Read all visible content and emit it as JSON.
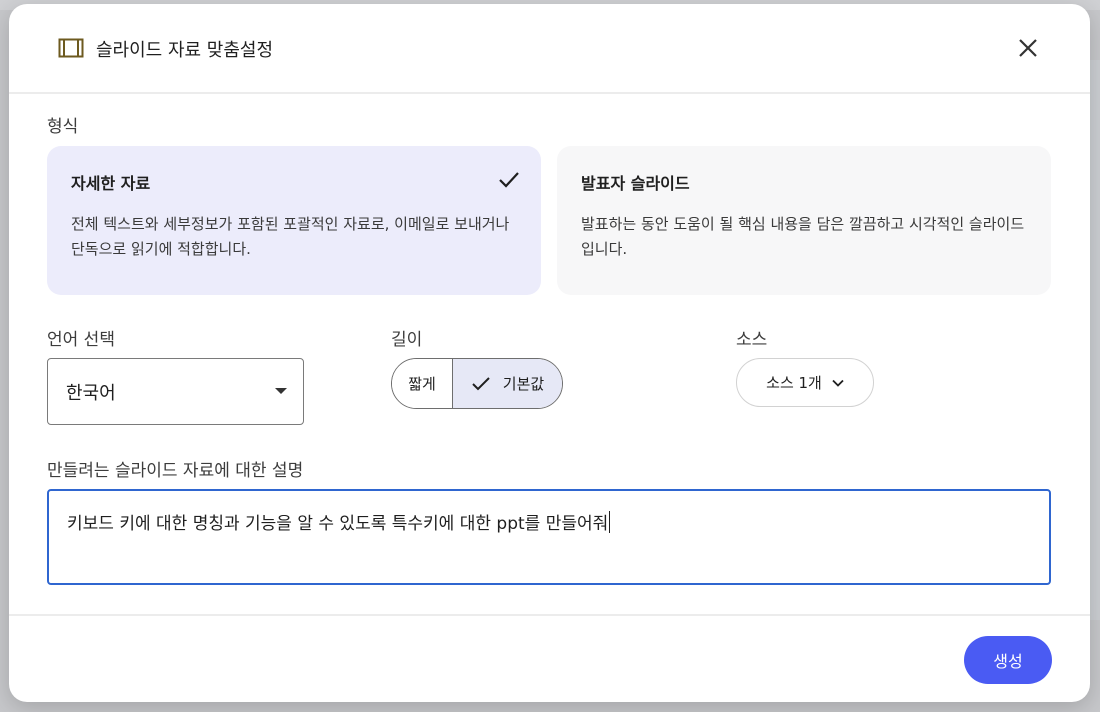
{
  "dialog": {
    "title": "슬라이드 자료 맞춤설정"
  },
  "format": {
    "label": "형식",
    "options": [
      {
        "title": "자세한 자료",
        "description": "전체 텍스트와 세부정보가 포함된 포괄적인 자료로, 이메일로 보내거나 단독으로 읽기에 적합합니다.",
        "selected": true
      },
      {
        "title": "발표자 슬라이드",
        "description": "발표하는 동안 도움이 될 핵심 내용을 담은 깔끔하고 시각적인 슬라이드입니다.",
        "selected": false
      }
    ]
  },
  "language": {
    "label": "언어 선택",
    "value": "한국어"
  },
  "length": {
    "label": "길이",
    "options": [
      "짧게",
      "기본값"
    ],
    "selected": "기본값"
  },
  "source": {
    "label": "소스",
    "value": "소스 1개"
  },
  "description": {
    "label": "만들려는 슬라이드 자료에 대한 설명",
    "value": "키보드 키에 대한 명칭과 기능을 알 수 있도록 특수키에 대한 ppt를 만들어줘"
  },
  "footer": {
    "generate_label": "생성"
  },
  "colors": {
    "accent": "#4a5bf3",
    "selected_card": "#ececfb",
    "focus_border": "#2f66d0"
  }
}
